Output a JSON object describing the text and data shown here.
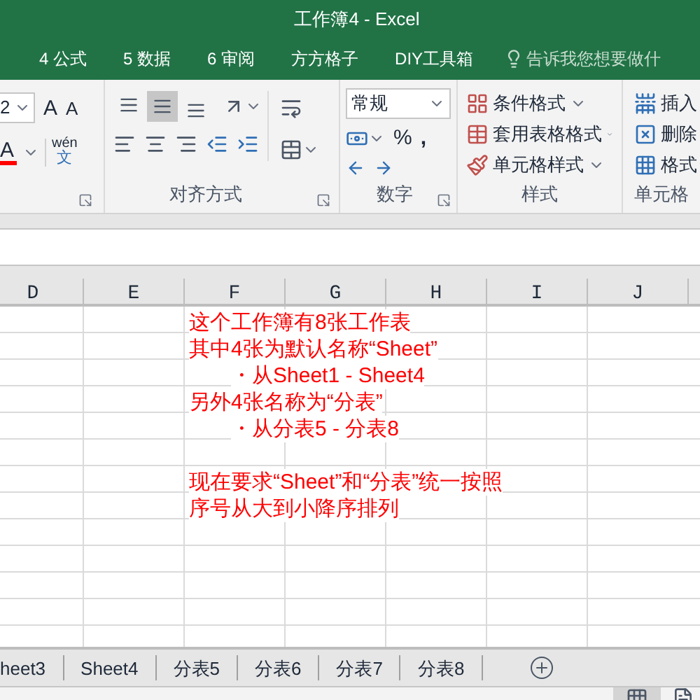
{
  "window": {
    "title": "工作簿4 - Excel"
  },
  "ribbon_tabs": [
    {
      "label": "4 公式",
      "selected": false
    },
    {
      "label": "5 数据",
      "selected": false
    },
    {
      "label": "6 审阅",
      "selected": false
    },
    {
      "label": "方方格子",
      "selected": false
    },
    {
      "label": "DIY工具箱",
      "selected": false
    }
  ],
  "tell_me": {
    "placeholder": "告诉我您想要做什"
  },
  "font": {
    "size": "2",
    "grow": "A",
    "shrink": "A",
    "color_label": "A",
    "phonetic_top": "wén",
    "phonetic_bottom": "文"
  },
  "alignment": {
    "label": "对齐方式",
    "vertical": [
      {
        "kind": "top",
        "selected": false
      },
      {
        "kind": "middle",
        "selected": true
      },
      {
        "kind": "bottom",
        "selected": false
      }
    ]
  },
  "number": {
    "format": "常规",
    "percent": "%",
    "comma": ",",
    "label": "数字"
  },
  "styles": {
    "buttons": [
      "条件格式",
      "套用表格格式",
      "单元格样式"
    ],
    "label": "样式"
  },
  "cells": {
    "buttons": [
      "插入",
      "删除",
      "格式"
    ],
    "label": "单元格"
  },
  "columns": [
    "D",
    "E",
    "F",
    "G",
    "H",
    "I",
    "J"
  ],
  "note": [
    {
      "text": "这个工作簿有8张工作表"
    },
    {
      "text": "其中4张为默认名称“Sheet”",
      "children": [
        {
          "text": "・从Sheet1 - Sheet4"
        }
      ]
    },
    {
      "text": "另外4张名称为“分表”",
      "children": [
        {
          "text": "・从分表5 - 分表8"
        }
      ]
    }
  ],
  "request": [
    "现在要求“Sheet”和“分表”统一按照",
    "序号从大到小降序排列"
  ],
  "sheet_tabs": [
    "heet3",
    "Sheet4",
    "分表5",
    "分表6",
    "分表7",
    "分表8"
  ]
}
